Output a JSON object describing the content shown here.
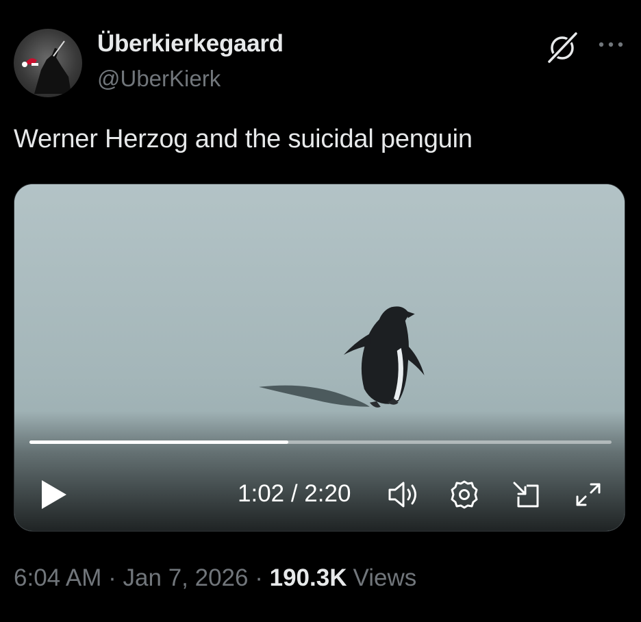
{
  "author": {
    "display_name": "Überkierkegaard",
    "handle": "@UberKierk"
  },
  "header_icons": {
    "grok": "grok-icon",
    "more": "more-icon"
  },
  "tweet": {
    "text": "Werner Herzog and the suicidal penguin"
  },
  "video": {
    "progress": 0.445,
    "time_display": "1:02 / 2:20",
    "controls": [
      "play-icon",
      "volume-icon",
      "settings-icon",
      "picture-in-picture-icon",
      "fullscreen-icon"
    ]
  },
  "footer": {
    "time": "6:04 AM",
    "separator": "·",
    "date": "Jan 7, 2026",
    "views_count": "190.3K",
    "views_label": "Views"
  },
  "colors": {
    "background": "#000000",
    "primary_text": "#e7e9ea",
    "secondary_text": "#71767b",
    "video_ice": "#a9b9bc"
  }
}
